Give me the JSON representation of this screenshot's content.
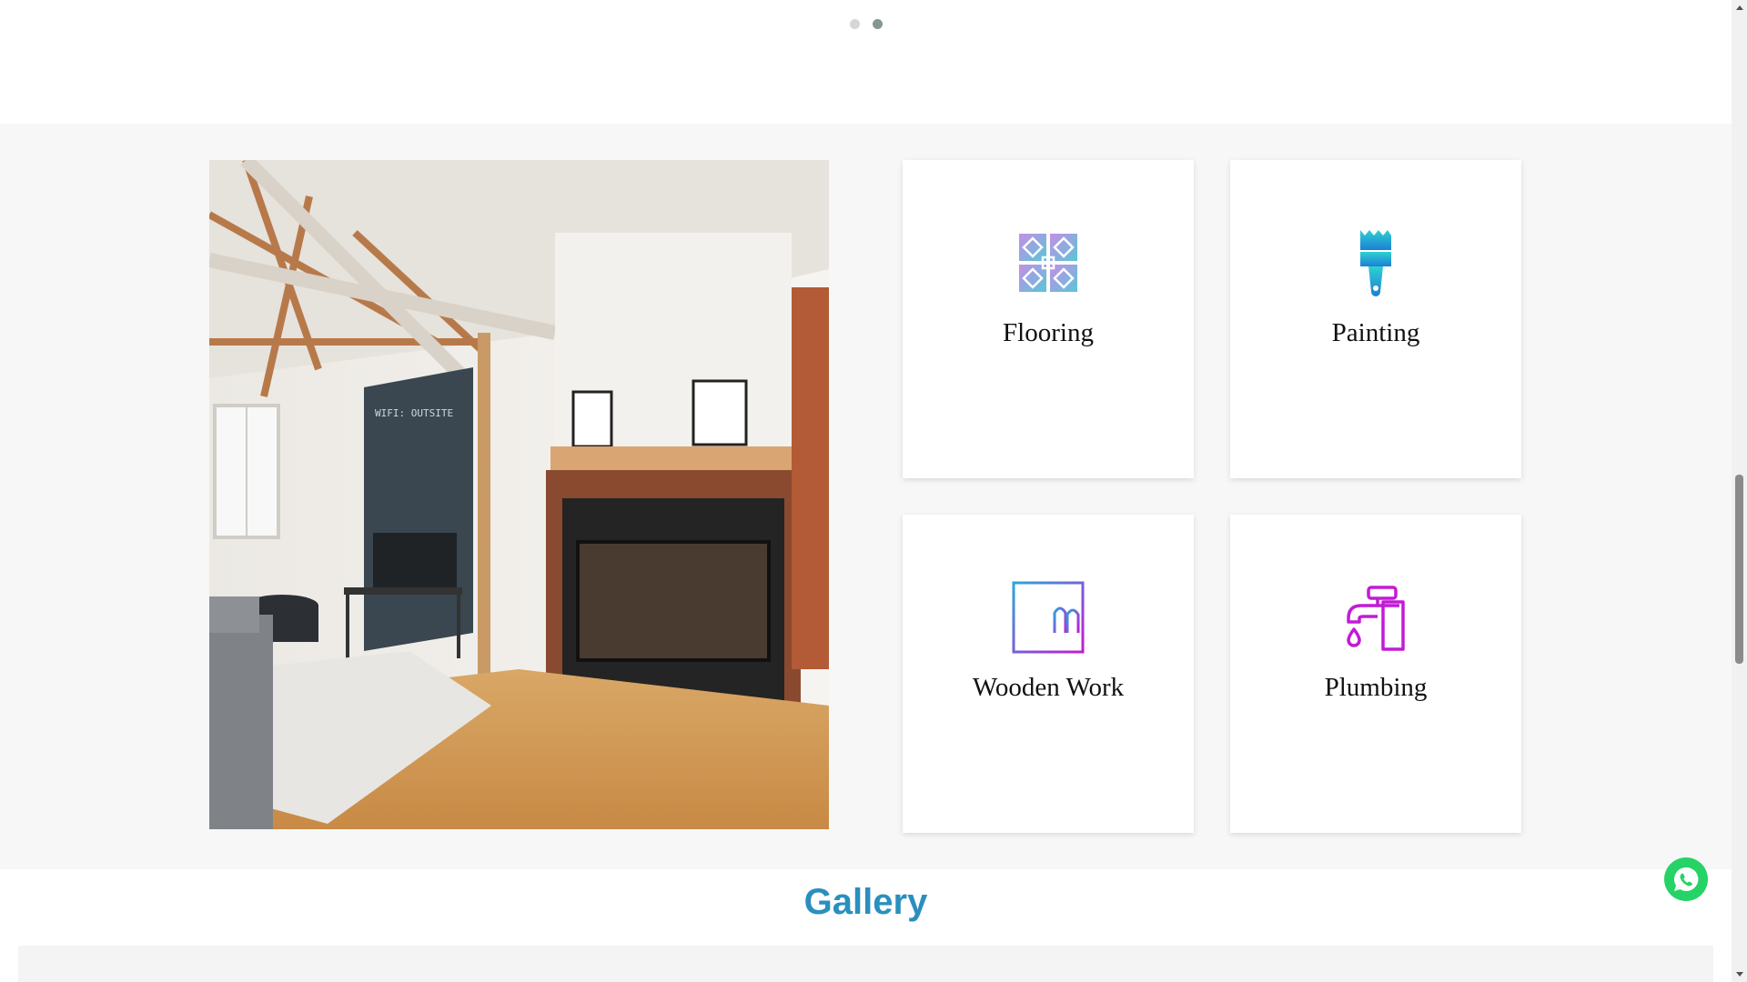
{
  "carousel": {
    "dots": [
      {
        "label": "slide 1",
        "active": false
      },
      {
        "label": "slide 2",
        "active": true
      }
    ]
  },
  "services": {
    "image": {
      "alt": "living room with fireplace"
    },
    "cards": [
      {
        "title": "Flooring",
        "icon": "floor-tile-icon"
      },
      {
        "title": "Painting",
        "icon": "paint-brush-icon"
      },
      {
        "title": "Wooden Work",
        "icon": "wardrobe-icon"
      },
      {
        "title": "Plumbing",
        "icon": "faucet-icon"
      }
    ]
  },
  "gallery": {
    "title": "Gallery"
  },
  "floating": {
    "whatsapp_icon": "whatsapp-icon"
  },
  "colors": {
    "accent_blue": "#2a8fbd",
    "whatsapp_green": "#25d366",
    "section_bg": "#f7f7f7"
  }
}
